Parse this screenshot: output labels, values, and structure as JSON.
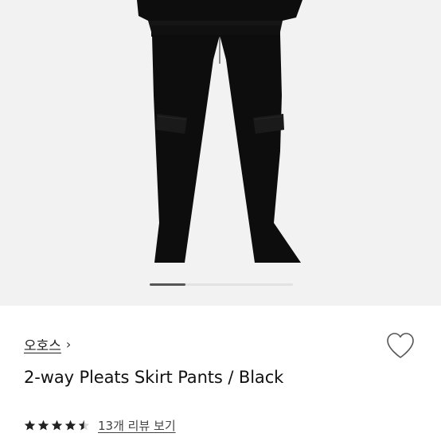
{
  "product": {
    "brand": "오호스",
    "brand_chevron": "›",
    "title": "2-way Pleats Skirt Pants / Black",
    "rating": 4.5,
    "rating_max": 5,
    "review_link": "13개 리뷰 보기"
  },
  "gallery": {
    "current_index": 1,
    "progress_fraction": 0.25
  },
  "colors": {
    "garment": "#0d0d0d",
    "image_bg": "#f2f2f2",
    "star": "#222222",
    "heart_outline": "#555555"
  },
  "icons": {
    "wish": "heart-outline-icon",
    "star": "star-icon",
    "chevron": "chevron-right-icon"
  }
}
